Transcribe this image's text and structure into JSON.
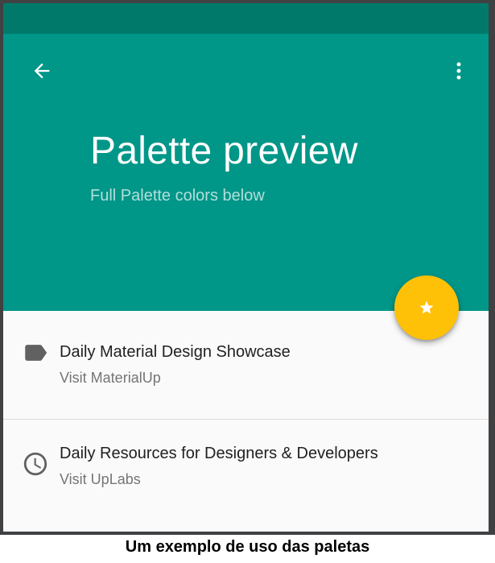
{
  "header": {
    "title": "Palette preview",
    "subtitle": "Full Palette colors below",
    "back_icon": "arrow-back-icon",
    "menu_icon": "more-vert-icon"
  },
  "fab": {
    "icon": "star-icon"
  },
  "list": {
    "items": [
      {
        "icon": "label-icon",
        "primary": "Daily Material Design Showcase",
        "secondary": "Visit MaterialUp"
      },
      {
        "icon": "clock-icon",
        "primary": "Daily Resources for Designers & Developers",
        "secondary": "Visit UpLabs"
      }
    ]
  },
  "caption": "Um exemplo de uso das paletas",
  "colors": {
    "primary": "#009688",
    "primary_dark": "#00796b",
    "accent": "#ffc107",
    "background": "#fafafa",
    "subtitle_text": "#b2dfdb"
  }
}
